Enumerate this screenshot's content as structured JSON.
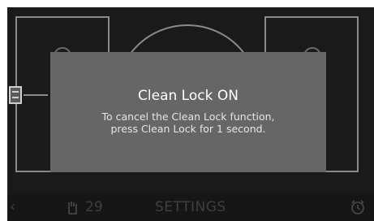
{
  "dialog": {
    "title": "Clean Lock ON",
    "message_line1": "To cancel the Clean Lock function,",
    "message_line2": "press Clean Lock for 1 second."
  },
  "bottom_bar": {
    "timer_value": "29",
    "settings_label": "SETTINGS"
  },
  "icons": [
    "left-arrow-icon",
    "hand-touch-icon",
    "alarm-clock-icon",
    "lock-status-icon"
  ],
  "colors": {
    "screen_background": "#1a1a1a",
    "dialog_background": "#666666",
    "dialog_text": "#ffffff",
    "dim_text": "#3f3f3f"
  }
}
